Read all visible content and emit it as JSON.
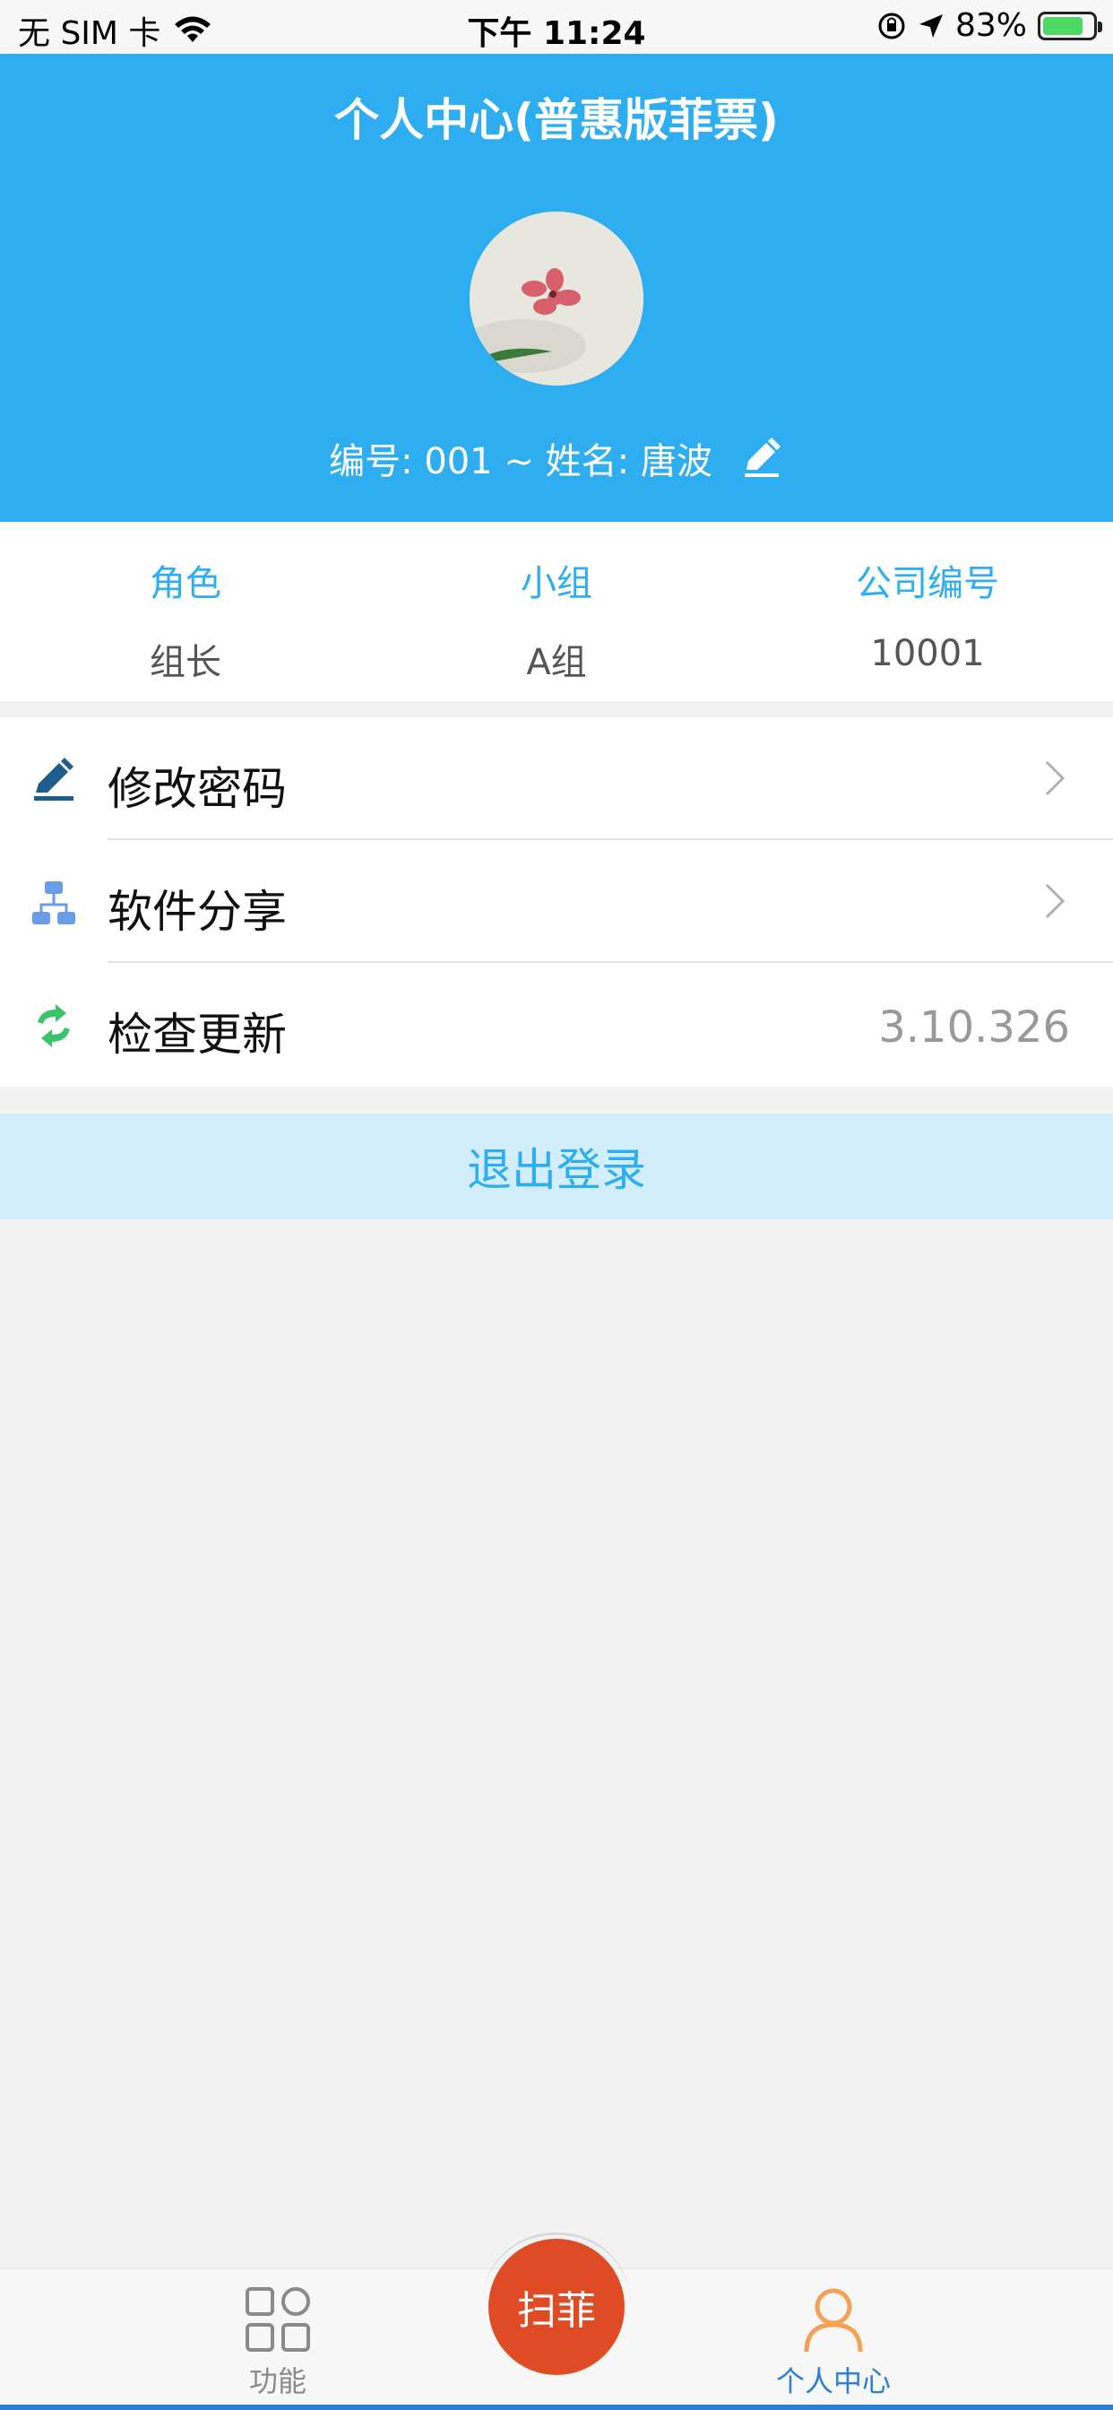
{
  "status_bar": {
    "carrier": "无 SIM 卡",
    "time": "下午 11:24",
    "battery": "83%"
  },
  "header": {
    "title": "个人中心(普惠版菲票)",
    "user_line": "编号: 001 ~ 姓名: 唐波"
  },
  "info": [
    {
      "label": "角色",
      "value": "组长"
    },
    {
      "label": "小组",
      "value": "A组"
    },
    {
      "label": "公司编号",
      "value": "10001"
    }
  ],
  "menu": [
    {
      "label": "修改密码",
      "icon": "edit-icon"
    },
    {
      "label": "软件分享",
      "icon": "share-icon"
    },
    {
      "label": "检查更新",
      "icon": "refresh-icon",
      "value": "3.10.326"
    }
  ],
  "logout_label": "退出登录",
  "tabbar": {
    "functions_label": "功能",
    "scan_label": "扫菲",
    "profile_label": "个人中心"
  },
  "colors": {
    "primary": "#2eaef0",
    "scan": "#df4b25",
    "active_tab": "#2c7fd6",
    "profile_icon": "#f5a053"
  }
}
